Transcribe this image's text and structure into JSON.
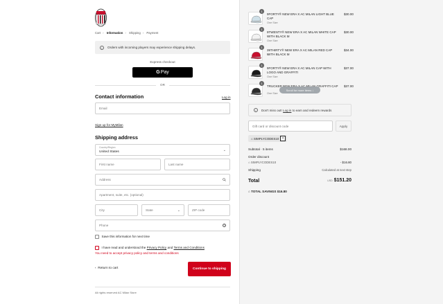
{
  "checkout": {
    "breadcrumbs": [
      "Cart",
      "Information",
      "Shipping",
      "Payment"
    ],
    "notice": "Orders with incoming players may experience shipping delays.",
    "express_label": "Express checkout",
    "gpay_label": "Pay",
    "or_label": "OR",
    "contact_heading": "Contact information",
    "login_link": "Log in",
    "email_placeholder": "Email",
    "signup_link": "Sign up for MyMilan",
    "shipping_heading": "Shipping address",
    "country": {
      "label": "Country/Region",
      "value": "United States"
    },
    "first_name_placeholder": "First name",
    "last_name_placeholder": "Last name",
    "address_placeholder": "Address",
    "apartment_placeholder": "Apartment, suite, etc. (optional)",
    "city_placeholder": "City",
    "state_placeholder": "State",
    "zip_placeholder": "ZIP code",
    "phone_placeholder": "Phone",
    "save_info_label": "Save this information for next time",
    "terms": {
      "pre": "I have read and understood the",
      "privacy": "Privacy Policy",
      "and": "and",
      "tc": "Terms and Conditions"
    },
    "terms_error": "You need to accept privacy policy and terms and conditions",
    "back_label": "Return to cart",
    "continue_label": "Continue to shipping",
    "footer": "All rights reserved AC Milan Store"
  },
  "summary": {
    "items": [
      {
        "qty": "1",
        "name": "9FORTY® NEW ERA X AC MILAN LIGHT BLUE CAP",
        "variant": "One Size",
        "price": "$30.00",
        "color": "#cfe0e8"
      },
      {
        "qty": "1",
        "name": "9TWENTY® NEW ERA X AC MILAN WHITE CAP WITH BLACK M",
        "variant": "One Size",
        "price": "$30.00",
        "color": "#f2f2f2"
      },
      {
        "qty": "1",
        "name": "39THIRTY® NEW ERA X AC MILAN RED CAP WITH BLACK M",
        "variant": "S",
        "price": "$34.00",
        "color": "#c8102e"
      },
      {
        "qty": "1",
        "name": "9FORTY® NEW ERA X AC MILAN CAP WITH LOGO AND GRAFFITI",
        "variant": "One Size",
        "price": "$37.00",
        "color": "#1a1a1a"
      },
      {
        "qty": "1",
        "name": "TRUCKER NEW ERA X AC MILAN GRAFFITI CAP",
        "variant": "One Size",
        "price": "$37.00",
        "color": "#2b2b2b"
      }
    ],
    "scroll_hint": "Scroll for more items",
    "rewards": {
      "pre": "Don't miss out!",
      "link": "Log in",
      "post": "to earn and redeem rewards"
    },
    "discount_placeholder": "Gift card or discount code",
    "apply_label": "Apply",
    "code_tag": "SIMPLYCODES10",
    "subtotal_label": "Subtotal · 5 items",
    "subtotal_value": "$168.00",
    "order_discount_label": "Order discount",
    "discount_code": "SIMPLYCODES10",
    "discount_value": "- $16.80",
    "shipping_label": "Shipping",
    "shipping_value": "Calculated at next step",
    "total_label": "Total",
    "total_currency": "USD",
    "total_value": "$151.20",
    "savings_label": "TOTAL SAVINGS",
    "savings_value": "$16.80"
  },
  "colors": {
    "accent": "#d0021b",
    "panel": "#f4f4f4"
  },
  "icons": [
    "ac-milan-logo",
    "info-icon",
    "chevron-right-icon",
    "chevron-down-icon",
    "search-icon",
    "help-icon",
    "chevron-left-icon",
    "tag-icon",
    "close-icon",
    "arrow-down-icon"
  ]
}
